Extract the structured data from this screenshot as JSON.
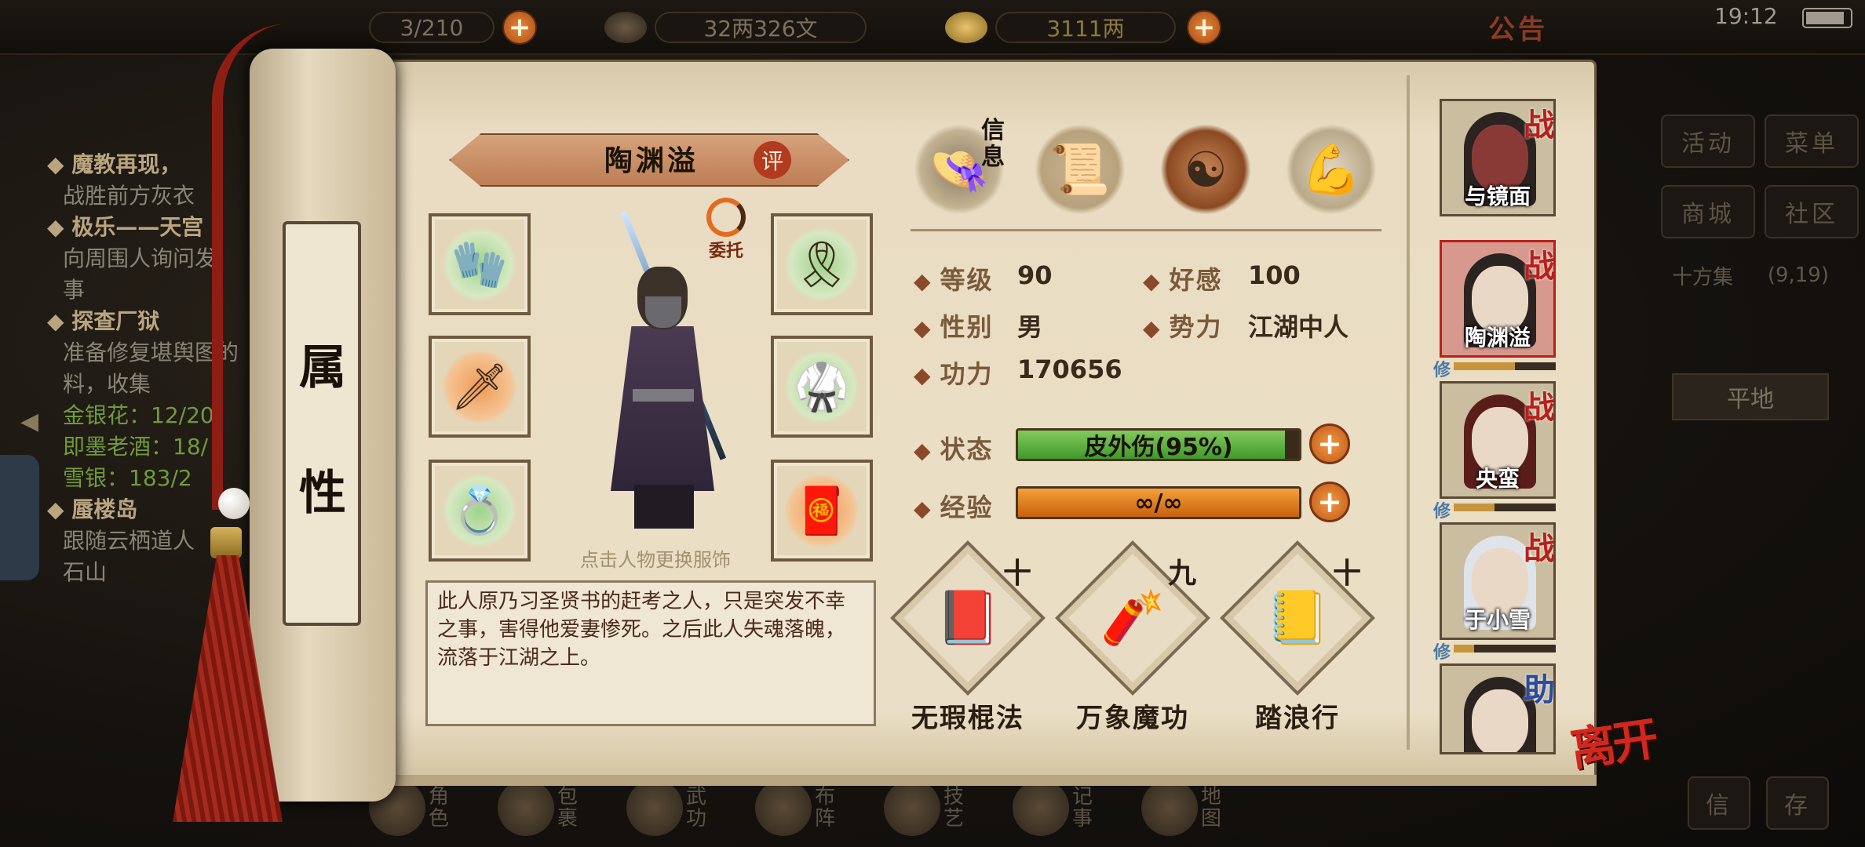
{
  "status_bar": {
    "time": "19:12"
  },
  "top_bar": {
    "stamina": "3/210",
    "silver": "32两326文",
    "ingots": "3111两",
    "announcement": "公告"
  },
  "quests": [
    {
      "title": "魔教再现，",
      "lines": [
        "战胜前方灰衣"
      ]
    },
    {
      "title": "极乐——天宫",
      "lines": [
        "向周围人询问发",
        "事"
      ]
    },
    {
      "title": "探查厂狱",
      "lines": [
        "准备修复堪舆图的",
        "料，收集"
      ],
      "items": [
        "金银花：12/20",
        "即墨老酒：18/",
        "雪银：183/2"
      ]
    },
    {
      "title": "蜃楼岛",
      "lines": [
        "跟随云栖道人",
        "石山"
      ]
    }
  ],
  "side_menu": {
    "activity": "活动",
    "menu": "菜单",
    "mall": "商城",
    "community": "社区",
    "location_name": "十方集",
    "location_coords": "(9,19)",
    "terrain": "平地",
    "mini_left": "信",
    "mini_right": "存"
  },
  "bottom_nav": [
    {
      "label": "角色",
      "icon": "character-icon"
    },
    {
      "label": "包裹",
      "icon": "bag-icon"
    },
    {
      "label": "武功",
      "icon": "martial-arts-icon"
    },
    {
      "label": "布阵",
      "icon": "formation-icon"
    },
    {
      "label": "技艺",
      "icon": "crafting-icon"
    },
    {
      "label": "记事",
      "icon": "journal-icon"
    },
    {
      "label": "地图",
      "icon": "map-icon"
    }
  ],
  "scroll": {
    "title_1": "属",
    "title_2": "性"
  },
  "character": {
    "name": "陶渊溢",
    "review": "评",
    "entrust": "委托",
    "outfit_hint": "点击人物更换服饰",
    "description": "此人原乃习圣贤书的赶考之人，只是突发不幸之事，害得他爱妻惨死。之后此人失魂落魄，流落于江湖之上。"
  },
  "tabs": {
    "info_label": "信息"
  },
  "stats": {
    "level_label": "等级",
    "level": "90",
    "affinity_label": "好感",
    "affinity": "100",
    "gender_label": "性别",
    "gender": "男",
    "faction_label": "势力",
    "faction": "江湖中人",
    "power_label": "功力",
    "power": "170656",
    "status_label": "状态",
    "status": "皮外伤(95%)",
    "status_percent": 95,
    "exp_label": "经验",
    "exp": "∞/∞",
    "exp_percent": 100
  },
  "skills": [
    {
      "name": "无瑕棍法",
      "level": "十",
      "icon": "staff-manual-icon"
    },
    {
      "name": "万象魔功",
      "level": "九",
      "icon": "scroll-icon"
    },
    {
      "name": "踏浪行",
      "level": "十",
      "icon": "book-icon"
    }
  ],
  "party": [
    {
      "name": "与镜面",
      "badge": "战",
      "xiu": "",
      "bar": null
    },
    {
      "name": "陶渊溢",
      "badge": "战",
      "xiu": "修",
      "bar": 0.6
    },
    {
      "name": "央蛮",
      "badge": "战",
      "xiu": "修",
      "bar": 0.4
    },
    {
      "name": "于小雪",
      "badge": "战",
      "xiu": "修",
      "bar": 0.2
    },
    {
      "name": "",
      "badge": "助",
      "xiu": "",
      "bar": null
    }
  ],
  "leave_label": "离开",
  "colors": {
    "accent_red": "#b8201a",
    "status_green": "#3f9a2a",
    "exp_orange": "#c8620c",
    "parchment": "#eadfc6"
  }
}
